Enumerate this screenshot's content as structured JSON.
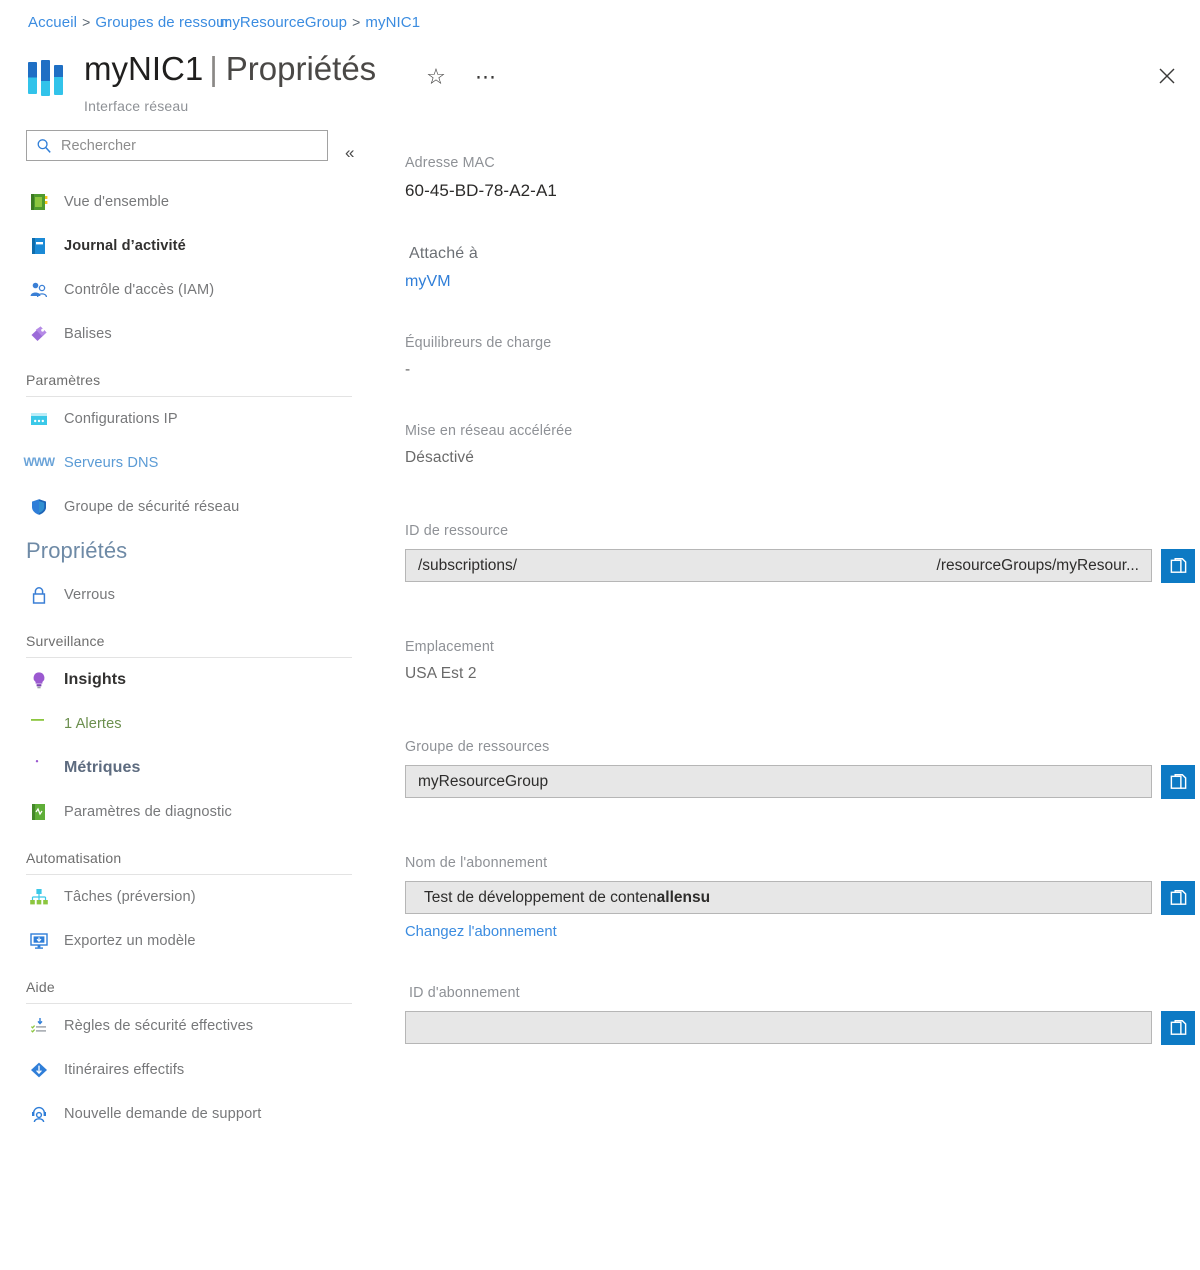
{
  "breadcrumb": {
    "home": "Accueil",
    "sep": ">",
    "resource_groups": "Groupes de ressour",
    "group_name": "myResourceGroup",
    "current": "myNIC1"
  },
  "header": {
    "resource_name": "myNIC1",
    "pipe": "|",
    "page_title": "Propriétés",
    "resource_type": "Interface réseau",
    "favorite_icon": "star-icon",
    "more_icon": "ellipsis-icon",
    "close_icon": "close-icon",
    "resource_icon": "network-interface-icon"
  },
  "sidebar": {
    "search": {
      "placeholder": "Rechercher",
      "value": "",
      "icon": "search-icon"
    },
    "collapse_icon": "chevron-double-left-icon",
    "top_items": [
      {
        "label": "Vue d'ensemble",
        "icon": "overview-icon",
        "state": "normal"
      },
      {
        "label": "Journal d’activité",
        "icon": "activity-log-icon",
        "state": "bold"
      },
      {
        "label": "Contrôle d'accès (IAM)",
        "icon": "access-control-icon",
        "state": "normal"
      },
      {
        "label": "Balises",
        "icon": "tag-icon",
        "state": "normal"
      }
    ],
    "groups": [
      {
        "title": "Paramètres",
        "items": [
          {
            "label": "Configurations IP",
            "icon": "ip-configurations-icon",
            "state": "normal"
          },
          {
            "label": "Serveurs DNS",
            "icon": "www-icon",
            "state": "blue"
          },
          {
            "label": "Groupe de sécurité réseau",
            "icon": "shield-icon",
            "state": "normal"
          },
          {
            "label": "Propriétés",
            "icon": "none",
            "state": "selected"
          },
          {
            "label": "Verrous",
            "icon": "lock-icon",
            "state": "normal"
          }
        ]
      },
      {
        "title": "Surveillance",
        "items": [
          {
            "label": "Insights",
            "icon": "lightbulb-icon",
            "state": "insights"
          },
          {
            "label": "1 Alertes",
            "icon": "alert-bar-icon",
            "state": "alerts"
          },
          {
            "label": "Métriques",
            "icon": "metrics-icon",
            "state": "metrics"
          },
          {
            "label": "Paramètres de diagnostic",
            "icon": "diagnostic-settings-icon",
            "state": "normal"
          }
        ]
      },
      {
        "title": "Automatisation",
        "items": [
          {
            "label": "Tâches (préversion)",
            "icon": "tasks-icon",
            "state": "normal"
          },
          {
            "label": "Exportez un modèle",
            "icon": "export-template-icon",
            "state": "normal"
          }
        ]
      },
      {
        "title": "Aide",
        "items": [
          {
            "label": "Règles de sécurité effectives",
            "icon": "effective-security-rules-icon",
            "state": "normal"
          },
          {
            "label": "Itinéraires effectifs",
            "icon": "effective-routes-icon",
            "state": "normal"
          },
          {
            "label": "Nouvelle demande de support",
            "icon": "support-request-icon",
            "state": "normal"
          }
        ]
      }
    ]
  },
  "properties": {
    "mac": {
      "label": "Adresse MAC",
      "value": "60-45-BD-78-A2-A1"
    },
    "attached_to": {
      "label": "Attaché à",
      "value": "myVM"
    },
    "load_balancers": {
      "label": "Équilibreurs de charge",
      "value": "-"
    },
    "accelerated_networking": {
      "label": "Mise en réseau accélérée",
      "value": "Désactivé"
    },
    "resource_id": {
      "label": "ID de ressource",
      "value_left": "/subscriptions/",
      "value_right": "/resourceGroups/myResour...",
      "copy_icon": "copy-icon"
    },
    "location": {
      "label": "Emplacement",
      "value": "USA Est 2"
    },
    "resource_group": {
      "label": "Groupe de ressources",
      "value": "myResourceGroup",
      "copy_icon": "copy-icon"
    },
    "subscription_name": {
      "label": "Nom de l'abonnement",
      "value": "Test de développement de conten",
      "value_overlap": "allensu",
      "change_link": "Changez l'abonnement",
      "copy_icon": "copy-icon"
    },
    "subscription_id": {
      "label": "ID d'abonnement",
      "value": "",
      "copy_icon": "copy-icon"
    }
  },
  "colors": {
    "link": "#3b8ce0",
    "copy_button": "#0d7ac4",
    "field_bg": "#e7e7e7",
    "label_grey": "#8e9196"
  }
}
